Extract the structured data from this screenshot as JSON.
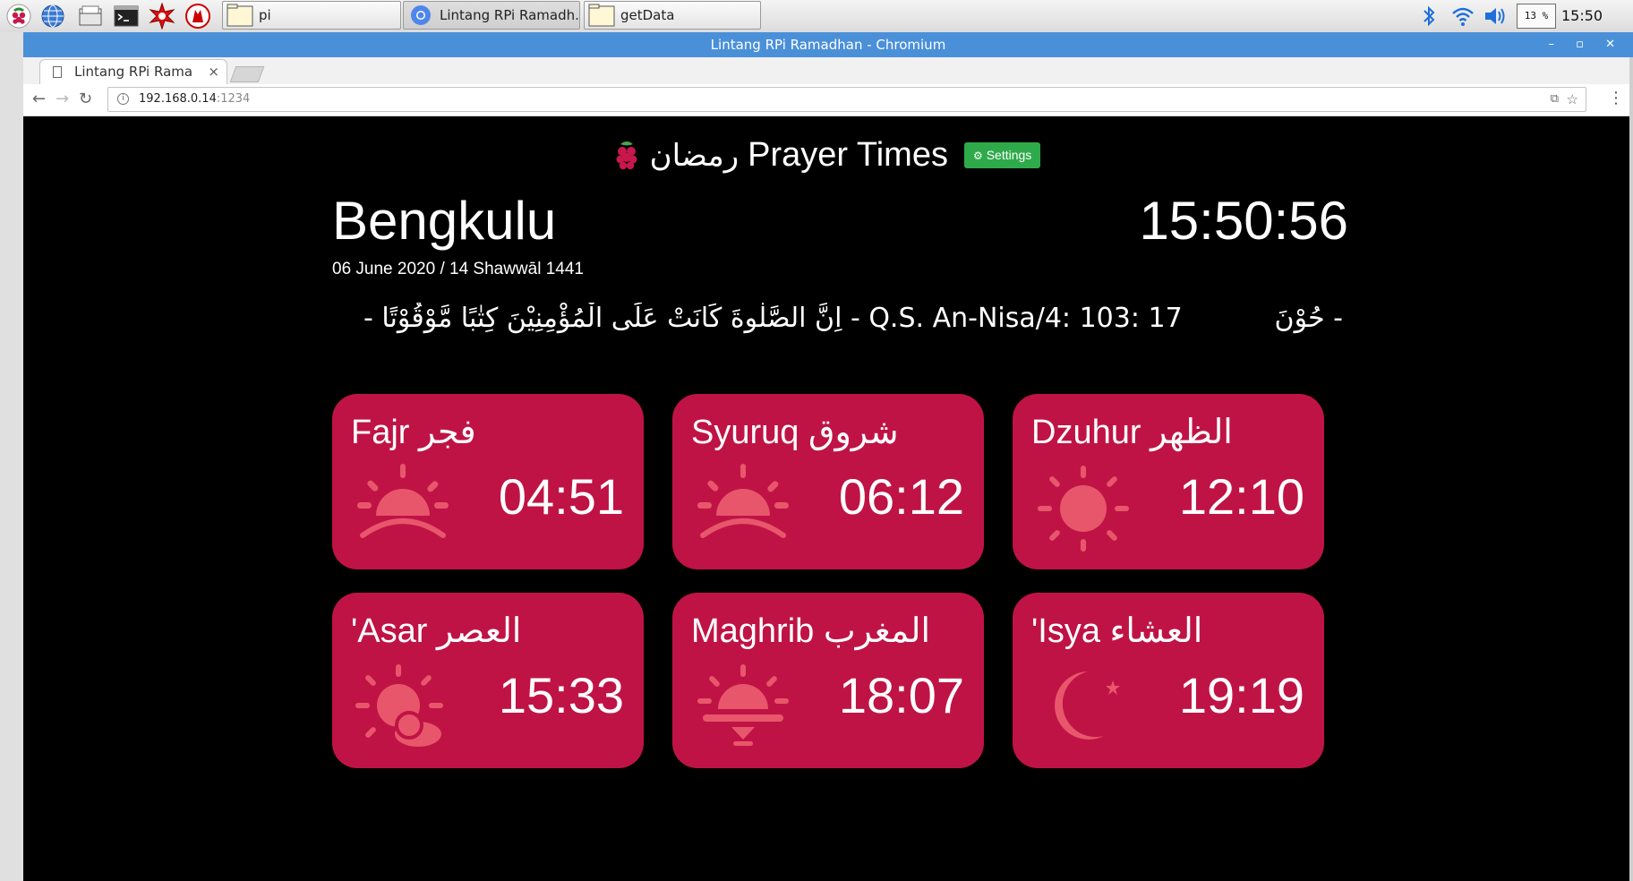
{
  "taskbar": {
    "launchers": [
      "raspberry-menu-icon",
      "browser-globe-icon",
      "file-manager-icon",
      "terminal-icon",
      "mathematica-icon",
      "wolfram-icon"
    ],
    "tasks": [
      {
        "label": "pi",
        "icon": "folder-icon"
      },
      {
        "label": "Lintang RPi Ramadh...",
        "icon": "chromium-icon"
      },
      {
        "label": "getData",
        "icon": "folder-icon"
      }
    ],
    "cpu_usage": "13 %",
    "clock": "15:50"
  },
  "window": {
    "title": "Lintang RPi Ramadhan - Chromium",
    "controls": "– ▫ ✕"
  },
  "browser": {
    "tab_title": "Lintang RPi Rama",
    "tab_close": "×",
    "url_host": "192.168.0.14",
    "url_port": ":1234"
  },
  "page": {
    "header_arabic": "رمضان",
    "header_title": "Prayer Times",
    "settings_label": "Settings",
    "city": "Bengkulu",
    "time": "15:50:56",
    "date": "06 June 2020 / 14 Shawwāl 1441",
    "verse": "- اِنَّ الصَّلٰوةَ كَانَتْ عَلَى الْمُؤْمِنِيْنَ كِتٰبًا مَّوْقُوْتًا - Q.S. An-Nisa/4: 103: 17",
    "verse_tail": "حُوْنَ -"
  },
  "prayers": [
    {
      "name": "Fajr فجر",
      "time": "04:51",
      "icon": "sunrise-icon"
    },
    {
      "name": "Syuruq شروق",
      "time": "06:12",
      "icon": "sunrise-icon"
    },
    {
      "name": "Dzuhur الظهر",
      "time": "12:10",
      "icon": "sun-icon"
    },
    {
      "name": "'Asar العصر",
      "time": "15:33",
      "icon": "sun-cloud-icon"
    },
    {
      "name": "Maghrib المغرب",
      "time": "18:07",
      "icon": "sunset-icon"
    },
    {
      "name": "'Isya العشاء",
      "time": "19:19",
      "icon": "moon-star-icon"
    }
  ],
  "colors": {
    "card_bg": "#c01345",
    "icon_fill": "#e8566c",
    "settings_bg": "#2eaa4a",
    "titlebar": "#4a90d9"
  }
}
